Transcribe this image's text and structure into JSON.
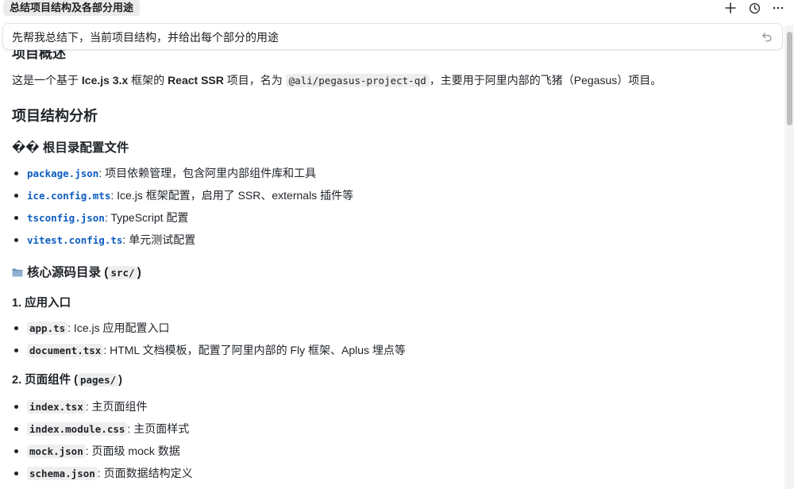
{
  "header": {
    "tab_title": "总结项目结构及各部分用途",
    "icons": [
      "plus-icon",
      "history-icon",
      "more-icon"
    ]
  },
  "prompt": {
    "text": "先帮我总结下，当前项目结构，并给出每个部分的用途"
  },
  "doc": {
    "clipped_heading": "项目概述",
    "intro": {
      "prefix": "这是一个基于 ",
      "framework": "Ice.js 3.x",
      "mid1": " 框架的 ",
      "type": "React SSR",
      "mid2": " 项目，名为 ",
      "package_name": "@ali/pegasus-project-qd",
      "suffix": "，主要用于阿里内部的飞猪（Pegasus）项目。"
    },
    "section_title": "项目结构分析",
    "root_config": {
      "title": "�� 根目录配置文件",
      "items": [
        {
          "file": "package.json",
          "desc": ": 项目依赖管理，包含阿里内部组件库和工具"
        },
        {
          "file": "ice.config.mts",
          "desc": ": Ice.js 框架配置，启用了 SSR、externals 插件等"
        },
        {
          "file": "tsconfig.json",
          "desc": ": TypeScript 配置"
        },
        {
          "file": "vitest.config.ts",
          "desc": ": 单元测试配置"
        }
      ]
    },
    "src_section": {
      "title": "核心源码目录 (",
      "code": "src/",
      "title_end": ")"
    },
    "app_entry": {
      "title": "1. 应用入口",
      "items": [
        {
          "file": "app.ts",
          "desc": ": Ice.js 应用配置入口"
        },
        {
          "file": "document.tsx",
          "desc": ": HTML 文档模板，配置了阿里内部的 Fly 框架、Aplus 埋点等"
        }
      ]
    },
    "pages": {
      "title": "2. 页面组件 (",
      "code": "pages/",
      "title_end": ")",
      "items": [
        {
          "file": "index.tsx",
          "desc": ": 主页面组件"
        },
        {
          "file": "index.module.css",
          "desc": ": 主页面样式"
        },
        {
          "file": "mock.json",
          "desc": ": 页面级 mock 数据"
        },
        {
          "file": "schema.json",
          "desc": ": 页面数据结构定义"
        }
      ]
    }
  },
  "colors": {
    "link": "#0b5cc1",
    "code_bg": "#eeeeee",
    "text": "#1f2328"
  }
}
